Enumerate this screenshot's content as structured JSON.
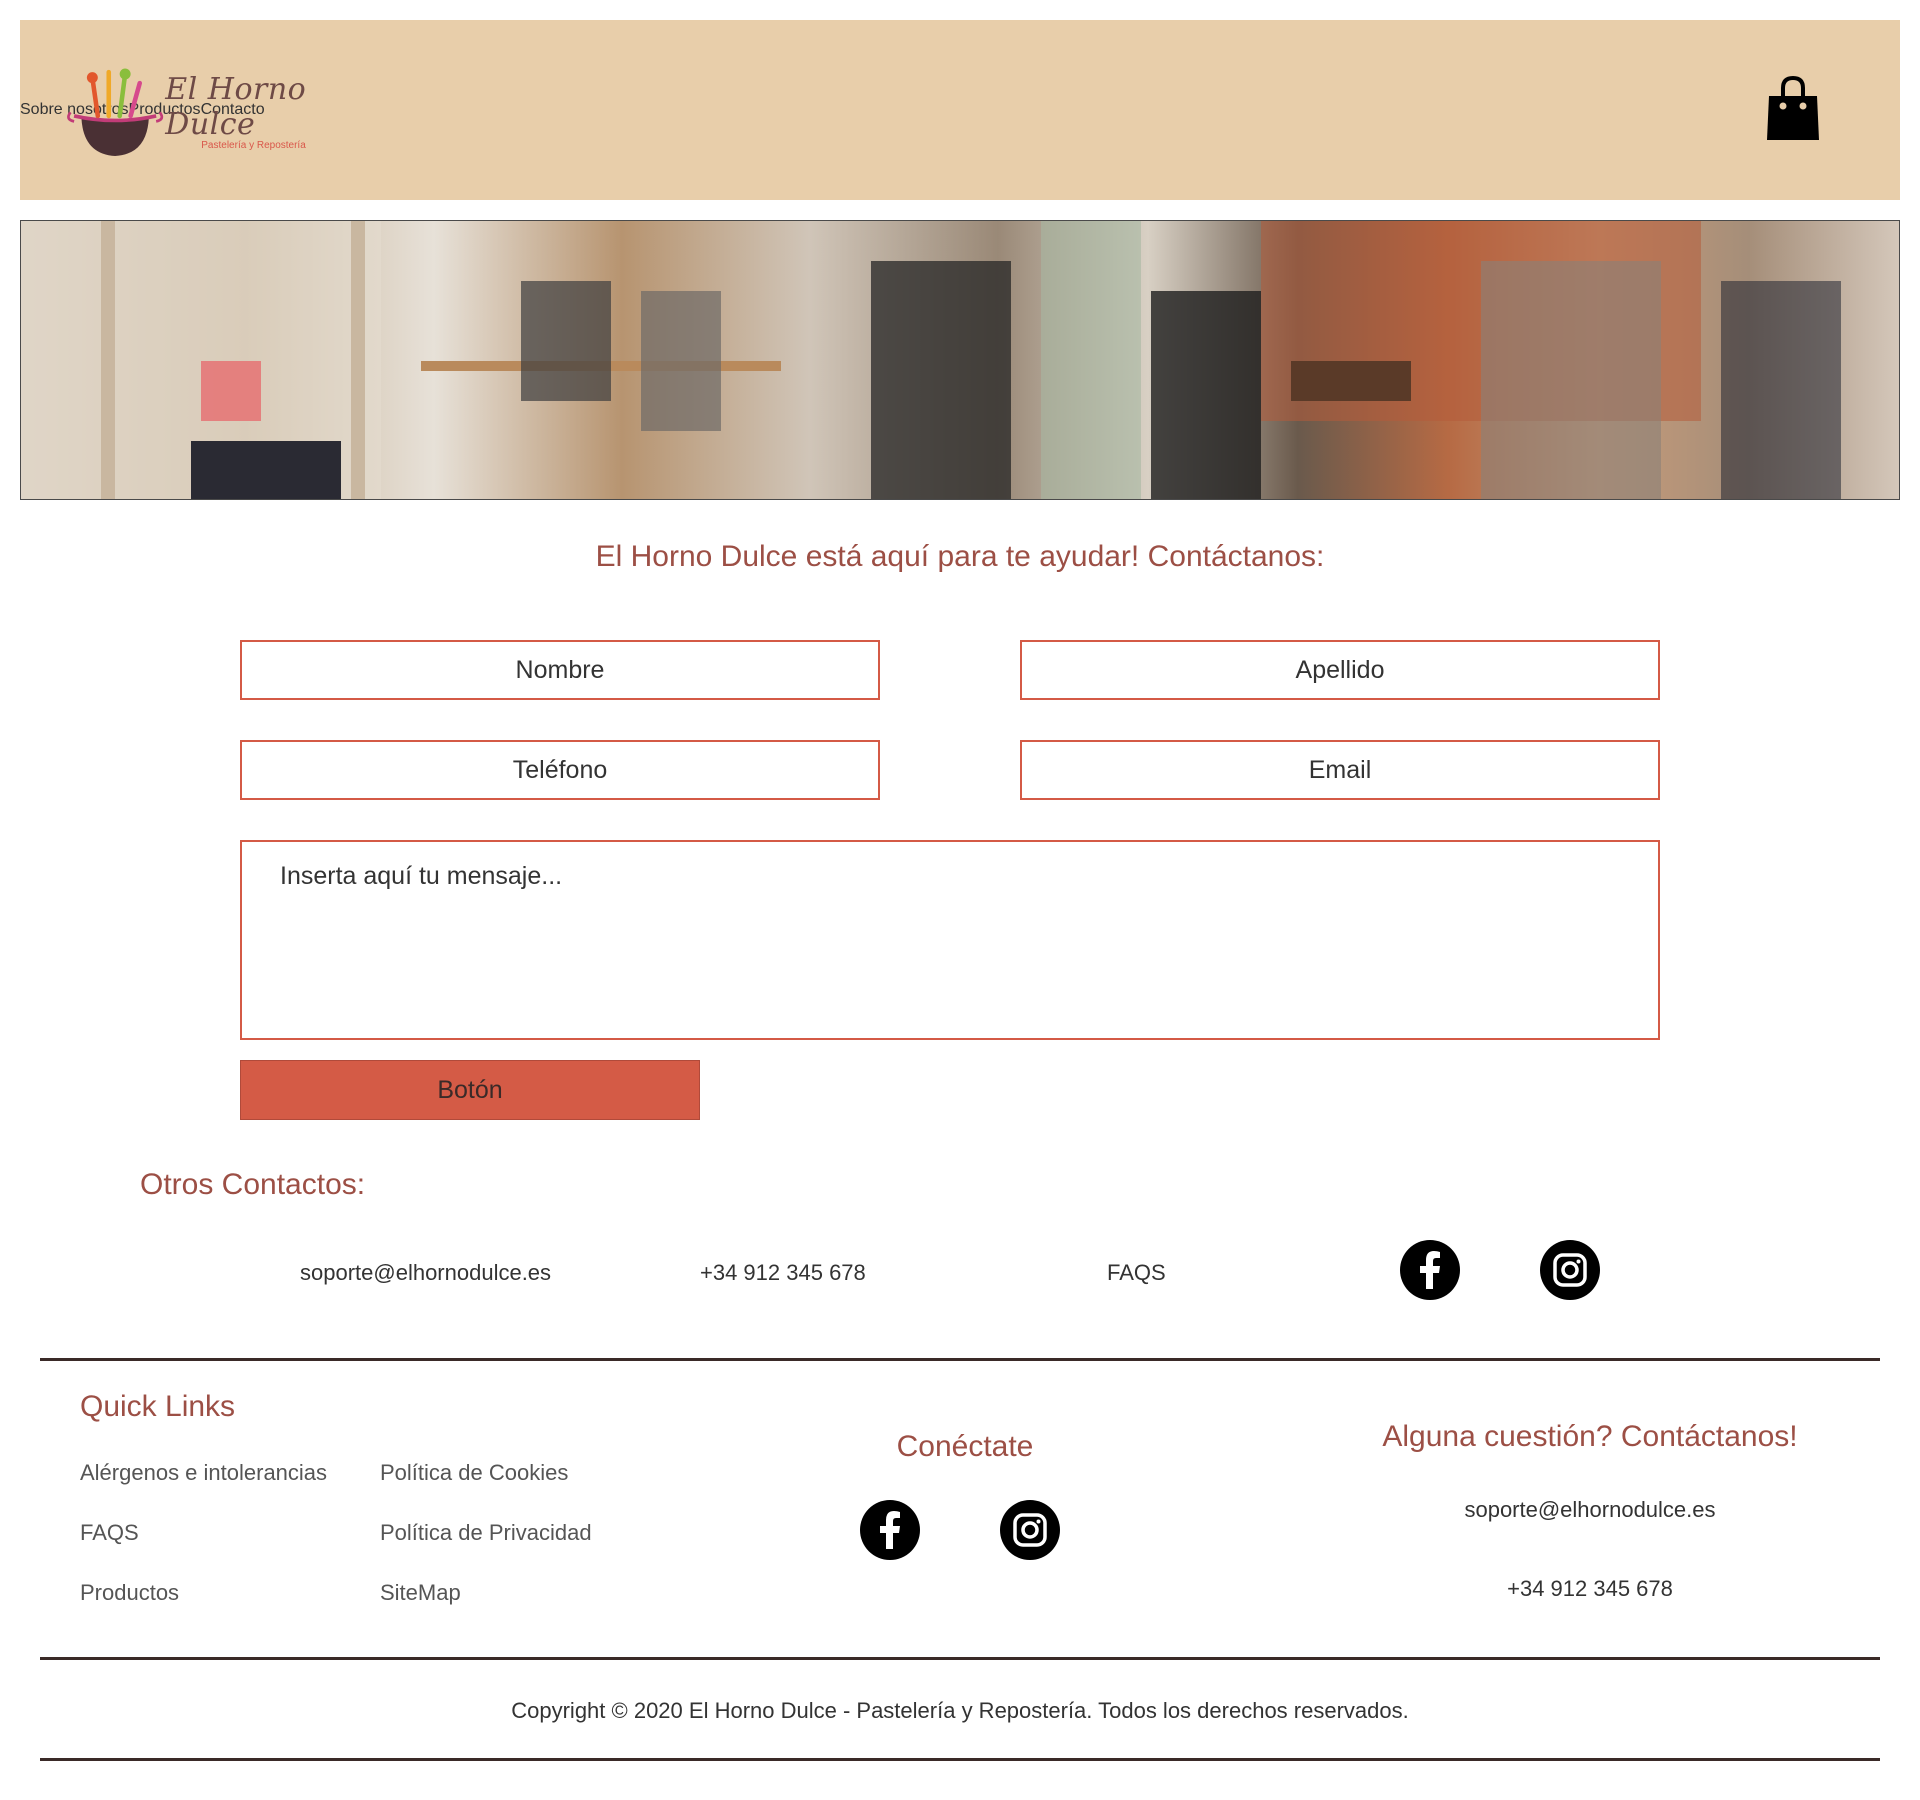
{
  "header": {
    "logo_title": "El Horno Dulce",
    "logo_subtitle": "Pastelería y Repostería",
    "nav": [
      "Sobre nosotros",
      "Productos",
      "Contacto"
    ],
    "cart_icon": "shopping-bag-icon"
  },
  "contact": {
    "title": "El Horno Dulce está aquí para te ayudar! Contáctanos:",
    "nombre_placeholder": "Nombre",
    "apellido_placeholder": "Apellido",
    "telefono_placeholder": "Teléfono",
    "email_placeholder": "Email",
    "message_placeholder": "Inserta aquí tu mensaje...",
    "button_label": "Botón"
  },
  "others": {
    "title": "Otros Contactos:",
    "email": "soporte@elhornodulce.es",
    "phone": "+34 912 345 678",
    "faqs": "FAQS",
    "icons": [
      "facebook-icon",
      "instagram-icon"
    ]
  },
  "footer": {
    "quick_links_title": "Quick Links",
    "quick_links": [
      "Alérgenos e intolerancias",
      "Política de Cookies",
      "FAQS",
      "Política de Privacidad",
      "Productos",
      "SiteMap"
    ],
    "connect_title": "Conéctate",
    "question_title": "Alguna cuestión? Contáctanos!",
    "email": "soporte@elhornodulce.es",
    "phone": "+34 912 345 678",
    "copyright": "Copyright © 2020 El Horno Dulce - Pastelería y Repostería. Todos los derechos reservados."
  },
  "colors": {
    "header_bg": "#e8ceaa",
    "accent": "#d45b46",
    "heading": "#9c4f45",
    "rule": "#3a2a28"
  }
}
